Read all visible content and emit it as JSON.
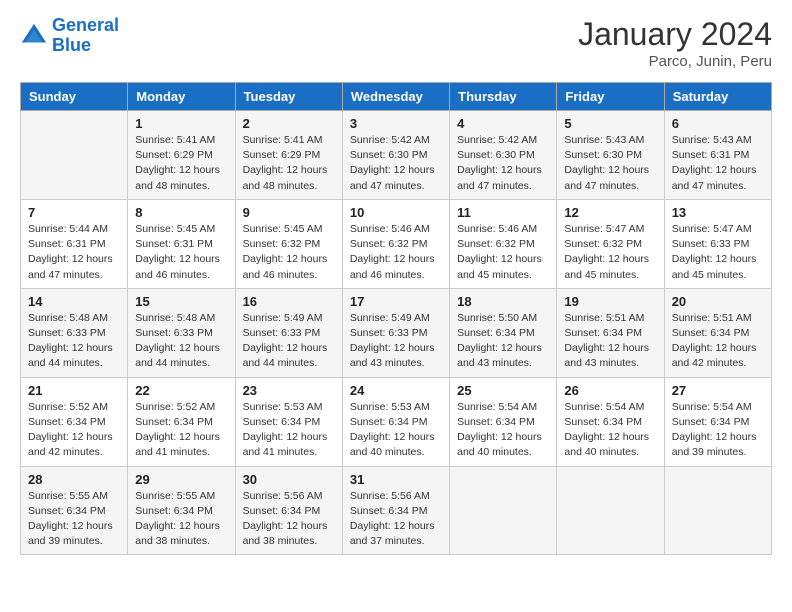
{
  "header": {
    "logo_line1": "General",
    "logo_line2": "Blue",
    "title": "January 2024",
    "subtitle": "Parco, Junin, Peru"
  },
  "days_of_week": [
    "Sunday",
    "Monday",
    "Tuesday",
    "Wednesday",
    "Thursday",
    "Friday",
    "Saturday"
  ],
  "weeks": [
    [
      {
        "day": "",
        "info": ""
      },
      {
        "day": "1",
        "info": "Sunrise: 5:41 AM\nSunset: 6:29 PM\nDaylight: 12 hours\nand 48 minutes."
      },
      {
        "day": "2",
        "info": "Sunrise: 5:41 AM\nSunset: 6:29 PM\nDaylight: 12 hours\nand 48 minutes."
      },
      {
        "day": "3",
        "info": "Sunrise: 5:42 AM\nSunset: 6:30 PM\nDaylight: 12 hours\nand 47 minutes."
      },
      {
        "day": "4",
        "info": "Sunrise: 5:42 AM\nSunset: 6:30 PM\nDaylight: 12 hours\nand 47 minutes."
      },
      {
        "day": "5",
        "info": "Sunrise: 5:43 AM\nSunset: 6:30 PM\nDaylight: 12 hours\nand 47 minutes."
      },
      {
        "day": "6",
        "info": "Sunrise: 5:43 AM\nSunset: 6:31 PM\nDaylight: 12 hours\nand 47 minutes."
      }
    ],
    [
      {
        "day": "7",
        "info": "Sunrise: 5:44 AM\nSunset: 6:31 PM\nDaylight: 12 hours\nand 47 minutes."
      },
      {
        "day": "8",
        "info": "Sunrise: 5:45 AM\nSunset: 6:31 PM\nDaylight: 12 hours\nand 46 minutes."
      },
      {
        "day": "9",
        "info": "Sunrise: 5:45 AM\nSunset: 6:32 PM\nDaylight: 12 hours\nand 46 minutes."
      },
      {
        "day": "10",
        "info": "Sunrise: 5:46 AM\nSunset: 6:32 PM\nDaylight: 12 hours\nand 46 minutes."
      },
      {
        "day": "11",
        "info": "Sunrise: 5:46 AM\nSunset: 6:32 PM\nDaylight: 12 hours\nand 45 minutes."
      },
      {
        "day": "12",
        "info": "Sunrise: 5:47 AM\nSunset: 6:32 PM\nDaylight: 12 hours\nand 45 minutes."
      },
      {
        "day": "13",
        "info": "Sunrise: 5:47 AM\nSunset: 6:33 PM\nDaylight: 12 hours\nand 45 minutes."
      }
    ],
    [
      {
        "day": "14",
        "info": "Sunrise: 5:48 AM\nSunset: 6:33 PM\nDaylight: 12 hours\nand 44 minutes."
      },
      {
        "day": "15",
        "info": "Sunrise: 5:48 AM\nSunset: 6:33 PM\nDaylight: 12 hours\nand 44 minutes."
      },
      {
        "day": "16",
        "info": "Sunrise: 5:49 AM\nSunset: 6:33 PM\nDaylight: 12 hours\nand 44 minutes."
      },
      {
        "day": "17",
        "info": "Sunrise: 5:49 AM\nSunset: 6:33 PM\nDaylight: 12 hours\nand 43 minutes."
      },
      {
        "day": "18",
        "info": "Sunrise: 5:50 AM\nSunset: 6:34 PM\nDaylight: 12 hours\nand 43 minutes."
      },
      {
        "day": "19",
        "info": "Sunrise: 5:51 AM\nSunset: 6:34 PM\nDaylight: 12 hours\nand 43 minutes."
      },
      {
        "day": "20",
        "info": "Sunrise: 5:51 AM\nSunset: 6:34 PM\nDaylight: 12 hours\nand 42 minutes."
      }
    ],
    [
      {
        "day": "21",
        "info": "Sunrise: 5:52 AM\nSunset: 6:34 PM\nDaylight: 12 hours\nand 42 minutes."
      },
      {
        "day": "22",
        "info": "Sunrise: 5:52 AM\nSunset: 6:34 PM\nDaylight: 12 hours\nand 41 minutes."
      },
      {
        "day": "23",
        "info": "Sunrise: 5:53 AM\nSunset: 6:34 PM\nDaylight: 12 hours\nand 41 minutes."
      },
      {
        "day": "24",
        "info": "Sunrise: 5:53 AM\nSunset: 6:34 PM\nDaylight: 12 hours\nand 40 minutes."
      },
      {
        "day": "25",
        "info": "Sunrise: 5:54 AM\nSunset: 6:34 PM\nDaylight: 12 hours\nand 40 minutes."
      },
      {
        "day": "26",
        "info": "Sunrise: 5:54 AM\nSunset: 6:34 PM\nDaylight: 12 hours\nand 40 minutes."
      },
      {
        "day": "27",
        "info": "Sunrise: 5:54 AM\nSunset: 6:34 PM\nDaylight: 12 hours\nand 39 minutes."
      }
    ],
    [
      {
        "day": "28",
        "info": "Sunrise: 5:55 AM\nSunset: 6:34 PM\nDaylight: 12 hours\nand 39 minutes."
      },
      {
        "day": "29",
        "info": "Sunrise: 5:55 AM\nSunset: 6:34 PM\nDaylight: 12 hours\nand 38 minutes."
      },
      {
        "day": "30",
        "info": "Sunrise: 5:56 AM\nSunset: 6:34 PM\nDaylight: 12 hours\nand 38 minutes."
      },
      {
        "day": "31",
        "info": "Sunrise: 5:56 AM\nSunset: 6:34 PM\nDaylight: 12 hours\nand 37 minutes."
      },
      {
        "day": "",
        "info": ""
      },
      {
        "day": "",
        "info": ""
      },
      {
        "day": "",
        "info": ""
      }
    ]
  ]
}
